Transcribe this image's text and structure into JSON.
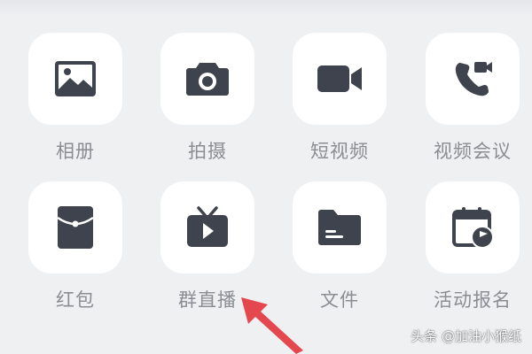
{
  "features": [
    {
      "label": "相册",
      "icon": "photo-album-icon"
    },
    {
      "label": "拍摄",
      "icon": "camera-icon"
    },
    {
      "label": "短视频",
      "icon": "video-camera-icon"
    },
    {
      "label": "视频会议",
      "icon": "video-call-icon"
    },
    {
      "label": "红包",
      "icon": "red-packet-icon"
    },
    {
      "label": "群直播",
      "icon": "live-tv-icon"
    },
    {
      "label": "文件",
      "icon": "folder-icon"
    },
    {
      "label": "活动报名",
      "icon": "event-calendar-icon"
    }
  ],
  "watermark": "头条 @加油小猴纸",
  "colors": {
    "icon": "#3f434d",
    "arrow": "#e5474f",
    "background": "#eef0f2",
    "tile": "#ffffff",
    "label": "#8a8d93"
  }
}
